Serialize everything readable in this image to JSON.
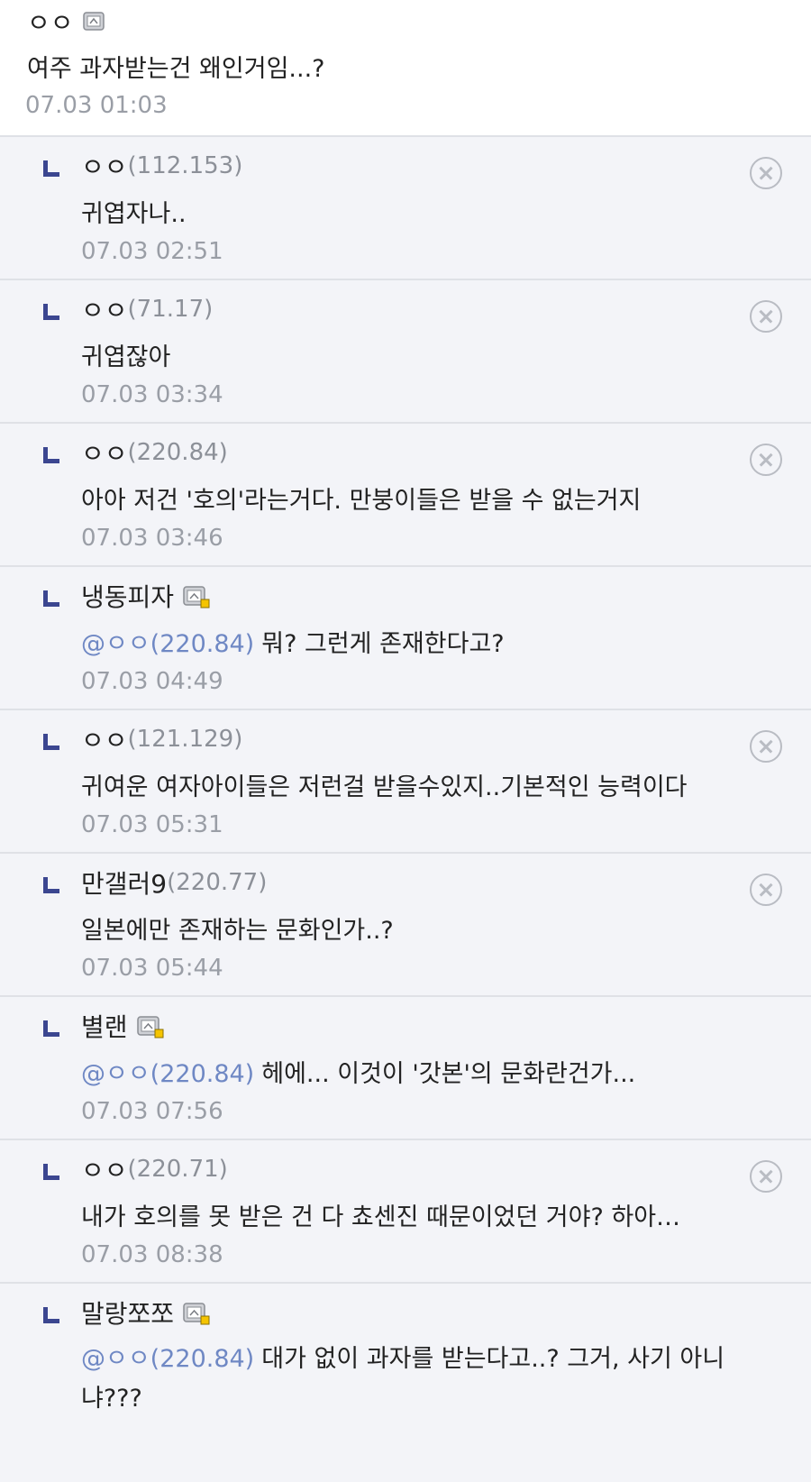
{
  "top_comment": {
    "nickname": "ㅇㅇ",
    "text": "여주 과자받는건 왜인거임...?",
    "date": "07.03 01:03",
    "icon": "gallery-member-icon"
  },
  "replies": [
    {
      "nickname": "ㅇㅇ",
      "ip": "(112.153)",
      "mention": "",
      "text": "귀엽자나..",
      "date": "07.03 02:51",
      "deletable": true
    },
    {
      "nickname": "ㅇㅇ",
      "ip": "(71.17)",
      "mention": "",
      "text": "귀엽잖아",
      "date": "07.03 03:34",
      "deletable": true
    },
    {
      "nickname": "ㅇㅇ",
      "ip": "(220.84)",
      "mention": "",
      "text": "아아 저건 '호의'라는거다. 만붕이들은 받을 수 없는거지",
      "date": "07.03 03:46",
      "deletable": true
    },
    {
      "nickname": "냉동피자",
      "ip": "",
      "member_icon": "gallery-member-icon",
      "mention": "@ㅇㅇ(220.84)",
      "text": "뭐? 그런게 존재한다고?",
      "date": "07.03 04:49",
      "deletable": false
    },
    {
      "nickname": "ㅇㅇ",
      "ip": "(121.129)",
      "mention": "",
      "text": "귀여운 여자아이들은 저런걸 받을수있지..기본적인 능력이다",
      "date": "07.03 05:31",
      "deletable": true
    },
    {
      "nickname": "만갤러9",
      "ip": "(220.77)",
      "mention": "",
      "text": "일본에만 존재하는 문화인가..?",
      "date": "07.03 05:44",
      "deletable": true
    },
    {
      "nickname": "별랜",
      "ip": "",
      "member_icon": "gallery-member-icon",
      "mention": "@ㅇㅇ(220.84)",
      "text": "헤에... 이것이 '갓본'의 문화란건가...",
      "date": "07.03 07:56",
      "deletable": false
    },
    {
      "nickname": "ㅇㅇ",
      "ip": "(220.71)",
      "mention": "",
      "text": "내가 호의를 못 받은 건 다 쵸센진 때문이었던 거야? 하아…",
      "date": "07.03 08:38",
      "deletable": true
    },
    {
      "nickname": "말랑쪼쪼",
      "ip": "",
      "member_icon": "gallery-member-icon",
      "mention": "@ㅇㅇ(220.84)",
      "text": "대가 없이 과자를 받는다고..? 그거, 사기 아니냐???",
      "date": "",
      "deletable": false
    }
  ],
  "colors": {
    "reply_bg": "#f3f4f8",
    "mention": "#6f88c4",
    "reply_mark": "#3b4690",
    "date": "#9a9ea6"
  }
}
